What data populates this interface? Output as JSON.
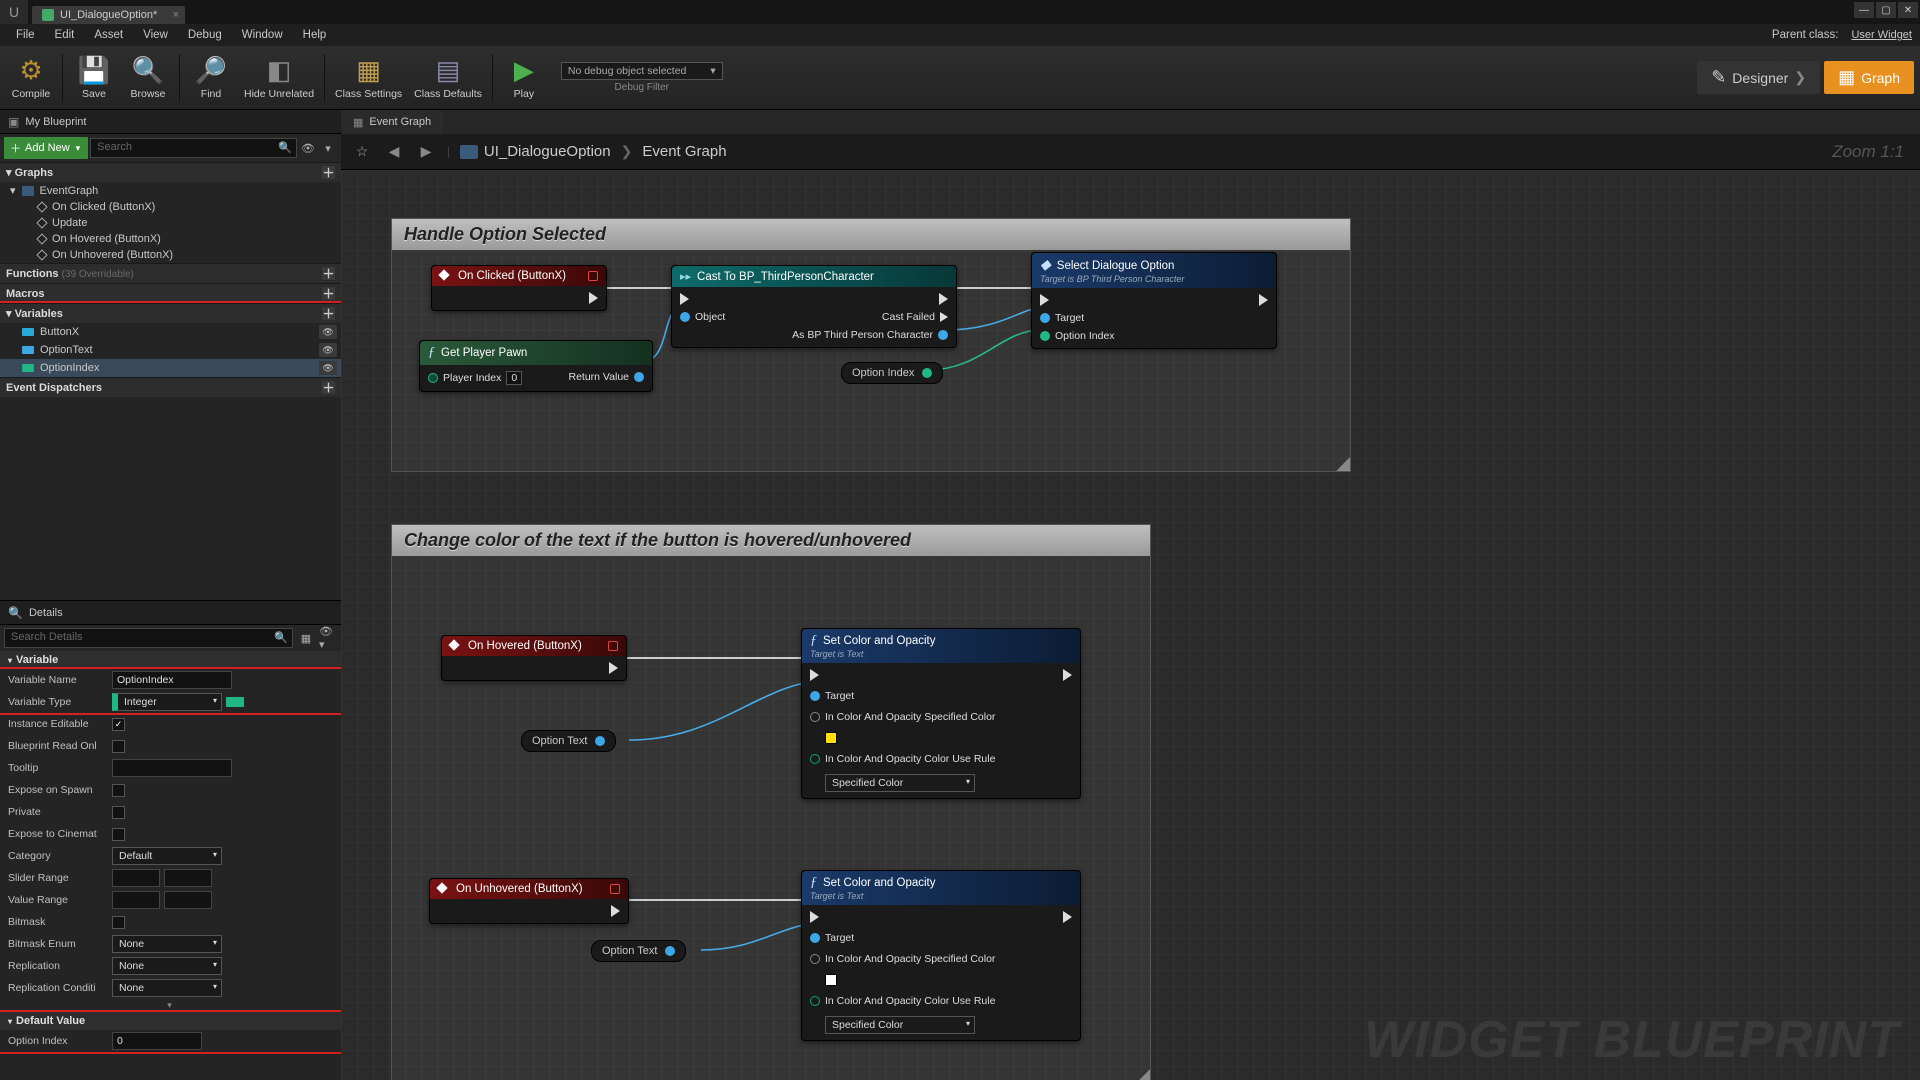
{
  "title_tab": "UI_DialogueOption*",
  "menu": [
    "File",
    "Edit",
    "Asset",
    "View",
    "Debug",
    "Window",
    "Help"
  ],
  "parent_class_label": "Parent class:",
  "parent_class": "User Widget",
  "toolbar": {
    "compile": "Compile",
    "save": "Save",
    "browse": "Browse",
    "find": "Find",
    "hide": "Hide Unrelated",
    "settings": "Class Settings",
    "defaults": "Class Defaults",
    "play": "Play",
    "debug_selected": "No debug object selected",
    "debug_label": "Debug Filter",
    "designer": "Designer",
    "graph": "Graph"
  },
  "mybp": {
    "title": "My Blueprint",
    "addnew": "Add New",
    "search_placeholder": "Search",
    "cat_graphs": "Graphs",
    "eventgraph": "EventGraph",
    "events": [
      "On Clicked (ButtonX)",
      "Update",
      "On Hovered (ButtonX)",
      "On Unhovered (ButtonX)"
    ],
    "cat_functions": "Functions",
    "functions_dim": "(39 Overridable)",
    "cat_macros": "Macros",
    "cat_variables": "Variables",
    "vars": [
      {
        "name": "ButtonX",
        "color": "#2aa9d8"
      },
      {
        "name": "OptionText",
        "color": "#3da8e8"
      },
      {
        "name": "OptionIndex",
        "color": "#1fb785"
      }
    ],
    "cat_dispatch": "Event Dispatchers"
  },
  "details": {
    "title": "Details",
    "search_placeholder": "Search Details",
    "cat_variable": "Variable",
    "rows": {
      "name_label": "Variable Name",
      "name_value": "OptionIndex",
      "type_label": "Variable Type",
      "type_value": "Integer",
      "inst_label": "Instance Editable",
      "inst_checked": true,
      "ro_label": "Blueprint Read Onl",
      "ro_checked": false,
      "tooltip_label": "Tooltip",
      "tooltip_value": "",
      "spawn_label": "Expose on Spawn",
      "spawn_checked": false,
      "private_label": "Private",
      "private_checked": false,
      "cine_label": "Expose to Cinemat",
      "cine_checked": false,
      "category_label": "Category",
      "category_value": "Default",
      "slider_label": "Slider Range",
      "value_label": "Value Range",
      "bitmask_label": "Bitmask",
      "bitmask_checked": false,
      "bitenum_label": "Bitmask Enum",
      "bitenum_value": "None",
      "repl_label": "Replication",
      "repl_value": "None",
      "replc_label": "Replication Conditi",
      "replc_value": "None"
    },
    "cat_default": "Default Value",
    "default_row": {
      "label": "Option Index",
      "value": "0"
    }
  },
  "graph": {
    "tab": "Event Graph",
    "bc1": "UI_DialogueOption",
    "bc2": "Event Graph",
    "zoom": "Zoom 1:1",
    "watermark": "WIDGET BLUEPRINT",
    "comment1": "Handle Option Selected",
    "comment2": "Change color of the text if the button is hovered/unhovered",
    "nodes": {
      "onclicked": "On Clicked (ButtonX)",
      "onhovered": "On Hovered (ButtonX)",
      "onunhovered": "On Unhovered (ButtonX)",
      "getpawn": "Get Player Pawn",
      "getpawn_pi": "Player Index",
      "getpawn_pi_val": "0",
      "getpawn_rv": "Return Value",
      "cast": "Cast To BP_ThirdPersonCharacter",
      "cast_obj": "Object",
      "cast_fail": "Cast Failed",
      "cast_as": "As BP Third Person Character",
      "select": "Select Dialogue Option",
      "select_sub": "Target is BP Third Person Character",
      "select_t": "Target",
      "select_idx": "Option Index",
      "optionindex": "Option Index",
      "optiontext": "Option Text",
      "setcolor": "Set Color and Opacity",
      "setcolor_sub": "Target is Text",
      "setcolor_t": "Target",
      "setcolor_c": "In Color And Opacity Specified Color",
      "setcolor_r": "In Color And Opacity Color Use Rule",
      "setcolor_r_val": "Specified Color"
    }
  }
}
